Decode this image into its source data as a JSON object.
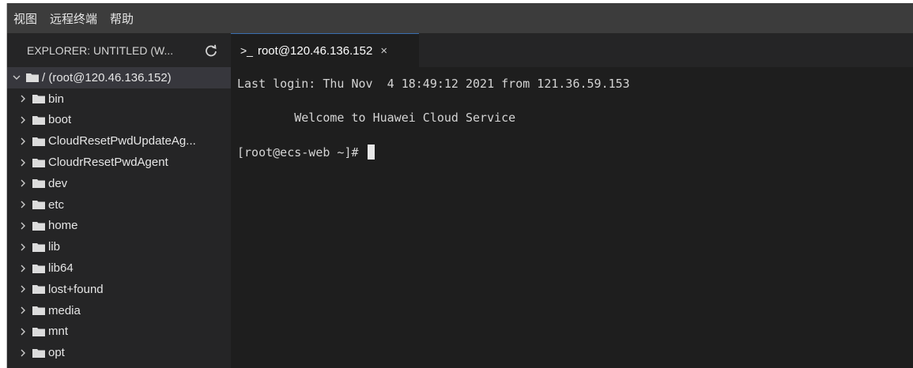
{
  "menu": {
    "items": [
      {
        "label": "视图"
      },
      {
        "label": "远程终端"
      },
      {
        "label": "帮助"
      }
    ]
  },
  "explorer": {
    "title": "EXPLORER: UNTITLED (W...",
    "refresh_icon": "refresh-icon",
    "root": {
      "label": "/ (root@120.46.136.152)",
      "expanded": true
    },
    "folders": [
      {
        "label": "bin"
      },
      {
        "label": "boot"
      },
      {
        "label": "CloudResetPwdUpdateAg..."
      },
      {
        "label": "CloudrResetPwdAgent"
      },
      {
        "label": "dev"
      },
      {
        "label": "etc"
      },
      {
        "label": "home"
      },
      {
        "label": "lib"
      },
      {
        "label": "lib64"
      },
      {
        "label": "lost+found"
      },
      {
        "label": "media"
      },
      {
        "label": "mnt"
      },
      {
        "label": "opt"
      }
    ]
  },
  "tab": {
    "prompt_symbol": ">_",
    "label": "root@120.46.136.152",
    "close_symbol": "×"
  },
  "terminal": {
    "lines": [
      "Last login: Thu Nov  4 18:49:12 2021 from 121.36.59.153",
      "        Welcome to Huawei Cloud Service",
      "[root@ecs-web ~]# "
    ]
  },
  "colors": {
    "menubar": "#3c3c3c",
    "sidebar": "#252526",
    "editor": "#1e1e1e",
    "selected_row": "#37373d",
    "tab_accent": "#3a6fb0"
  }
}
